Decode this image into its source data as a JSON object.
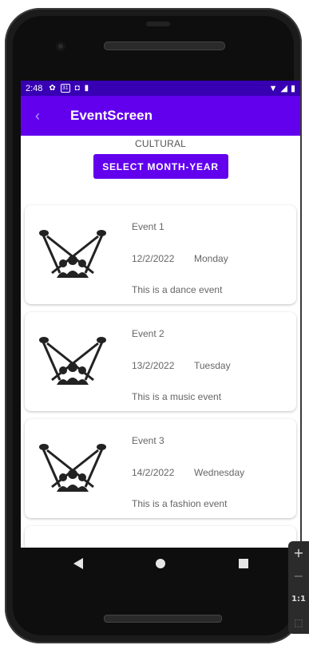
{
  "status_bar": {
    "time": "2:48",
    "icons": [
      "gear-icon",
      "calendar-icon",
      "shield-icon",
      "sdcard-icon"
    ],
    "calendar_day": "31"
  },
  "app_bar": {
    "title": "EventScreen"
  },
  "section": {
    "label": "CULTURAL"
  },
  "select_button": {
    "label": "SELECT MONTH-YEAR"
  },
  "events": [
    {
      "name": "Event 1",
      "date": "12/2/2022",
      "day": "Monday",
      "description": "This is a dance event"
    },
    {
      "name": "Event 2",
      "date": "13/2/2022",
      "day": "Tuesday",
      "description": "This is a music event"
    },
    {
      "name": "Event 3",
      "date": "14/2/2022",
      "day": "Wednesday",
      "description": "This is a fashion event"
    }
  ],
  "zoom_panel": {
    "plus": "+",
    "minus": "−",
    "ratio": "1:1"
  },
  "colors": {
    "primary": "#6200ee",
    "primary_dark": "#3700b3",
    "device": "#1b1b1b"
  }
}
